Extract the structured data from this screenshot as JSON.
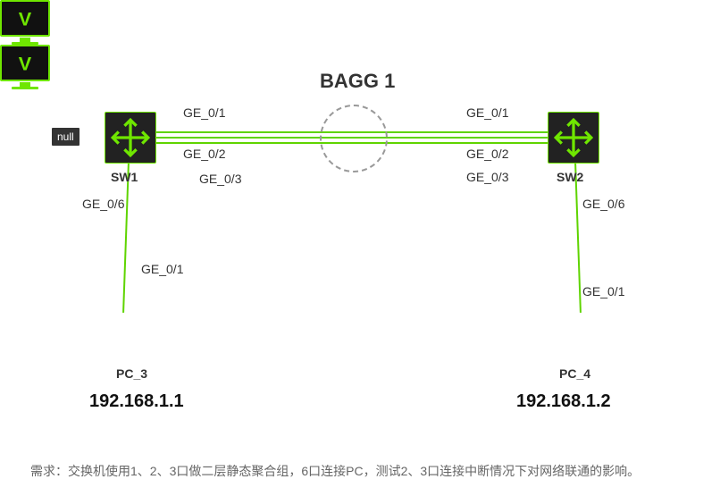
{
  "topology": {
    "title": "BAGG 1",
    "nullLabel": "null",
    "requirementText": "需求：交换机使用1、2、3口做二层静态聚合组，6口连接PC，测试2、3口连接中断情况下对网络联通的影响。",
    "devices": {
      "sw1": {
        "name": "SW1"
      },
      "sw2": {
        "name": "SW2"
      },
      "pc3": {
        "name": "PC_3",
        "ip": "192.168.1.1"
      },
      "pc4": {
        "name": "PC_4",
        "ip": "192.168.1.2"
      }
    },
    "portLabels": {
      "sw1_ge01": "GE_0/1",
      "sw1_ge02": "GE_0/2",
      "sw1_ge03": "GE_0/3",
      "sw1_ge06": "GE_0/6",
      "sw2_ge01": "GE_0/1",
      "sw2_ge02": "GE_0/2",
      "sw2_ge03": "GE_0/3",
      "sw2_ge06": "GE_0/6",
      "pc3_ge01": "GE_0/1",
      "pc4_ge01": "GE_0/1"
    },
    "links": [
      {
        "from": "SW1",
        "port_from": "GE_0/1",
        "to": "SW2",
        "port_to": "GE_0/1",
        "group": "BAGG1"
      },
      {
        "from": "SW1",
        "port_from": "GE_0/2",
        "to": "SW2",
        "port_to": "GE_0/2",
        "group": "BAGG1"
      },
      {
        "from": "SW1",
        "port_from": "GE_0/3",
        "to": "SW2",
        "port_to": "GE_0/3",
        "group": "BAGG1"
      },
      {
        "from": "SW1",
        "port_from": "GE_0/6",
        "to": "PC_3",
        "port_to": "GE_0/1"
      },
      {
        "from": "SW2",
        "port_from": "GE_0/6",
        "to": "PC_4",
        "port_to": "GE_0/1"
      }
    ]
  }
}
